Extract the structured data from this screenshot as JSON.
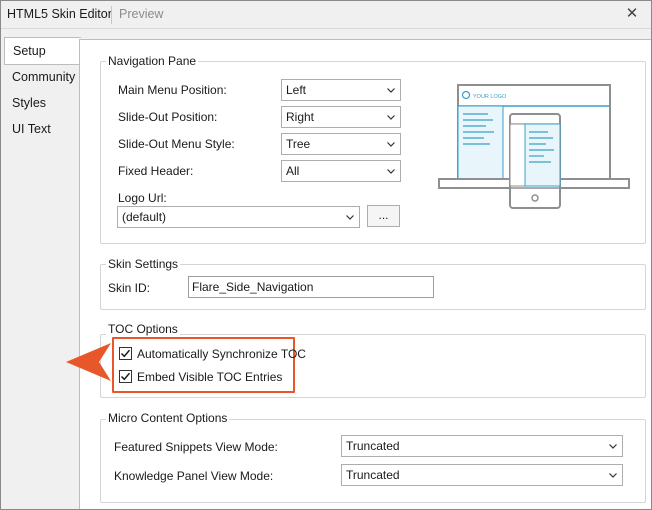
{
  "window": {
    "tabs": [
      "HTML5 Skin Editor",
      "Preview"
    ],
    "close_glyph": "✕"
  },
  "side_tabs": [
    "Setup",
    "Community",
    "Styles",
    "UI Text"
  ],
  "navigation_pane": {
    "title": "Navigation Pane",
    "main_menu_position": {
      "label": "Main Menu Position:",
      "value": "Left"
    },
    "slide_out_position": {
      "label": "Slide-Out Position:",
      "value": "Right"
    },
    "slide_out_menu_style": {
      "label": "Slide-Out Menu Style:",
      "value": "Tree"
    },
    "fixed_header": {
      "label": "Fixed Header:",
      "value": "All"
    },
    "logo_url": {
      "label": "Logo Url:",
      "value": "(default)",
      "browse_label": "..."
    },
    "preview_logo_text": "YOUR LOGO"
  },
  "skin_settings": {
    "title": "Skin Settings",
    "skin_id": {
      "label": "Skin ID:",
      "value": "Flare_Side_Navigation"
    }
  },
  "toc_options": {
    "title": "TOC Options",
    "auto_sync": {
      "label": "Automatically Synchronize TOC",
      "checked": true
    },
    "embed_visible": {
      "label": "Embed Visible TOC Entries",
      "checked": true
    }
  },
  "micro_content": {
    "title": "Micro Content Options",
    "featured_snippets": {
      "label": "Featured Snippets View Mode:",
      "value": "Truncated"
    },
    "knowledge_panel": {
      "label": "Knowledge Panel View Mode:",
      "value": "Truncated"
    }
  },
  "colors": {
    "highlight": "#e8572a",
    "preview_accent": "#3aa0c8",
    "preview_device": "#8f8f8f"
  },
  "icons": {
    "chevron": "chevron-down-icon",
    "check": "check-icon",
    "arrow": "callout-arrow-icon",
    "close": "close-icon"
  }
}
